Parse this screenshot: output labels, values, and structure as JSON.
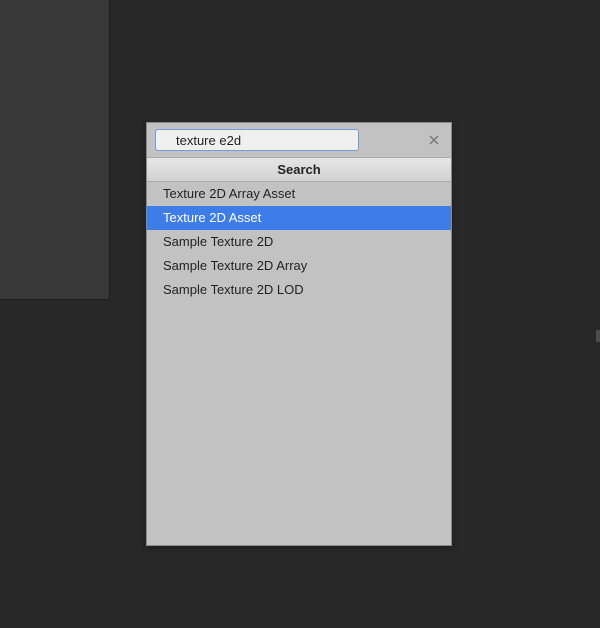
{
  "search": {
    "query": "texture e2d",
    "placeholder": ""
  },
  "section": {
    "title": "Search"
  },
  "results": [
    {
      "label": "Texture 2D Array Asset",
      "selected": false
    },
    {
      "label": "Texture 2D Asset",
      "selected": true
    },
    {
      "label": "Sample Texture 2D",
      "selected": false
    },
    {
      "label": "Sample Texture 2D Array",
      "selected": false
    },
    {
      "label": "Sample Texture 2D LOD",
      "selected": false
    }
  ],
  "colors": {
    "selection": "#3e7de7",
    "popup_bg": "#c2c2c2",
    "app_bg": "#282828"
  }
}
